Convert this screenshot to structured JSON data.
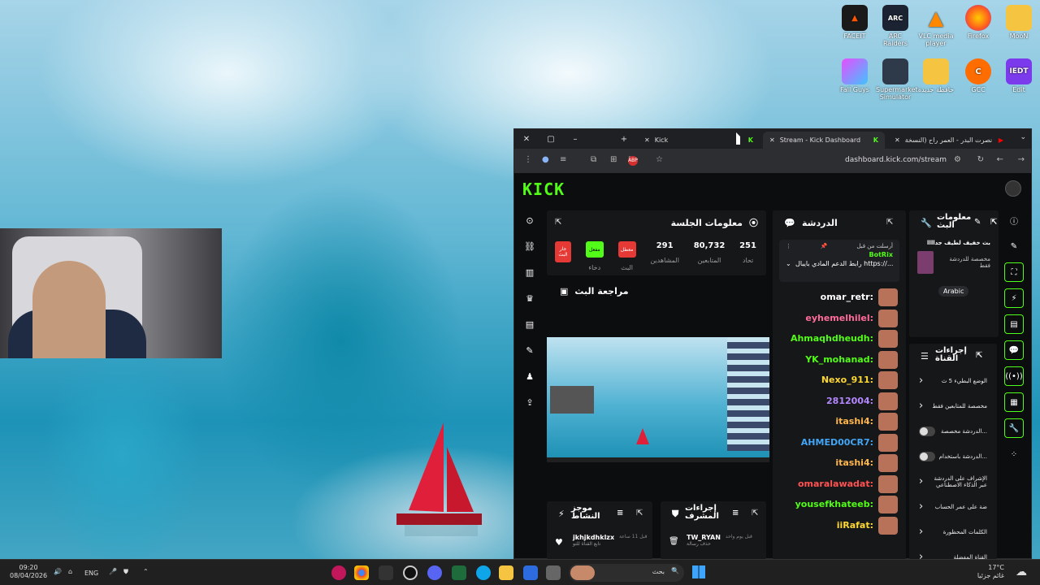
{
  "desktop": {
    "icons": [
      {
        "label": "FACEIT",
        "icon": "faceit-icon"
      },
      {
        "label": "ARC Raiders",
        "icon": "arc-raiders-icon"
      },
      {
        "label": "VLC media player",
        "icon": "vlc-icon"
      },
      {
        "label": "Firefox",
        "icon": "firefox-icon"
      },
      {
        "label": "MooN",
        "icon": "folder-icon"
      },
      {
        "label": "Fall Guys",
        "icon": "fall-guys-icon"
      },
      {
        "label": "Supermarket Simulator",
        "icon": "supermarket-icon"
      },
      {
        "label": "حافظة جديدة",
        "icon": "folder-icon"
      },
      {
        "label": "GCC",
        "icon": "gcc-icon"
      },
      {
        "label": "Edit",
        "icon": "iedt-icon"
      }
    ],
    "iedt_text": "IEDT",
    "arc_text": "ARC"
  },
  "browser": {
    "tabs": {
      "kick": "Kick",
      "dashboard": "Stream - Kick Dashboard",
      "youtube": "نصرت البدر - العمر راح (النسخة"
    },
    "url": "dashboard.kick.com/stream",
    "adblock": "ABP"
  },
  "kick": {
    "logo": "KICK",
    "session": {
      "title": "معلومات الجلسة",
      "stats": [
        {
          "value": "251",
          "label": "تحاد"
        },
        {
          "value": "80,732",
          "label": "المتابعين"
        },
        {
          "value": "291",
          "label": "المشاهدين"
        }
      ],
      "btn_offline": "معطل",
      "btn_on": "مفعل",
      "btn_live": "جار البث",
      "btn_offline_sub": "البث",
      "btn_on_sub": "دخاء"
    },
    "preview": {
      "title": "مراجعة البث"
    },
    "chat": {
      "title": "الدردشة",
      "pinned_by": "أرسلت من قبل",
      "pinned_user": "BotRix",
      "pinned_msg": "رابط الدعم المادي بايبال https://...",
      "messages": [
        {
          "user": "omar_retr:",
          "color": "#ffffff"
        },
        {
          "user": "eyhemelhilel:",
          "color": "#ff6b9a"
        },
        {
          "user": "Ahmaqhdheudh:",
          "color": "#53fc18"
        },
        {
          "user": "YK_mohanad:",
          "color": "#53fc18"
        },
        {
          "user": "Nexo_911:",
          "color": "#fdd835"
        },
        {
          "user": "2812004:",
          "color": "#b388ff"
        },
        {
          "user": "itashi4:",
          "color": "#ffb74d"
        },
        {
          "user": "AHMED00CR7:",
          "color": "#42a5f5"
        },
        {
          "user": "itashi4:",
          "color": "#ffb74d"
        },
        {
          "user": "omaralawadat:",
          "color": "#ff5252"
        },
        {
          "user": "yousefkhateeb:",
          "color": "#53fc18"
        },
        {
          "user": "iiRafat:",
          "color": "#fdd835"
        }
      ]
    },
    "stream_info": {
      "title": "معلومات البث",
      "stream_title": "بث خفيف لطيف جداااا",
      "category": "مخصصة للدردشة فقط",
      "language": "Arabic"
    },
    "channel_actions": {
      "title": "إجراءات القناة",
      "items": [
        "الوضع البطيء 5 ث",
        "مخصصة للمتابعين فقط",
        "الدردشة مخصصة...",
        "الدردشة باستخدام...",
        "الإشراف على الدردشة عبر الذكاء الاصطناعي",
        "ضة على عمر الحساب",
        "الكلمات المحظورة",
        "القناة المفضلة"
      ]
    },
    "activity": {
      "title": "موجز النشاط",
      "user": "jkhjkdhklzx",
      "time": "قبل 11 ساعة",
      "desc": "تابع القناة للتو"
    },
    "mod_actions": {
      "title": "إجراءات المشرف",
      "user": "TW_RYAN",
      "time": "قبل يوم واحد",
      "desc": "حذف رسالة"
    }
  },
  "taskbar": {
    "time": "09:20",
    "date": "08/04/2026",
    "lang": "ENG",
    "search": "بحث",
    "weather_temp": "17°C",
    "weather_desc": "غائم جزئيا"
  }
}
